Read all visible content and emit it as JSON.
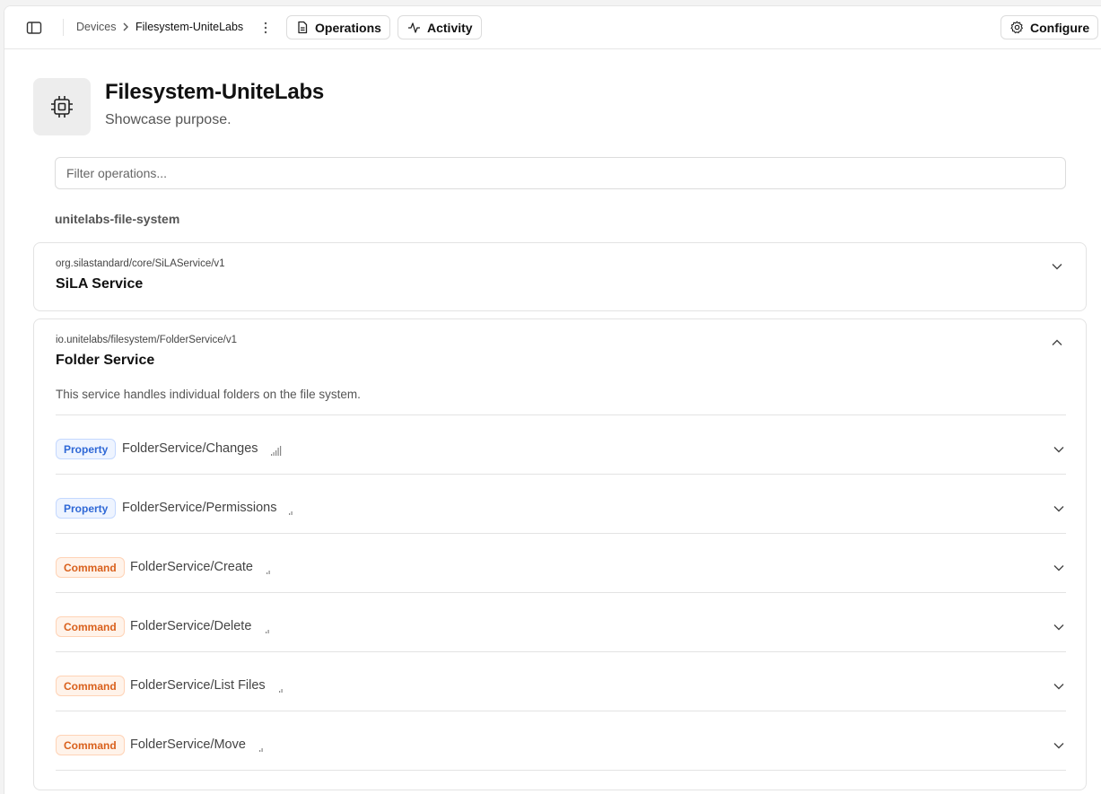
{
  "header": {
    "breadcrumb": {
      "devices": "Devices",
      "current": "Filesystem-UniteLabs"
    },
    "operations_label": "Operations",
    "activity_label": "Activity",
    "configure_label": "Configure"
  },
  "device": {
    "title": "Filesystem-UniteLabs",
    "subtitle": "Showcase purpose.",
    "icon": "chip-icon"
  },
  "filter": {
    "placeholder": "Filter operations..."
  },
  "group": {
    "label": "unitelabs-file-system"
  },
  "features": [
    {
      "id": "org.silastandard/core/SiLAService/v1",
      "name": "SiLA Service",
      "expanded": false
    },
    {
      "id": "io.unitelabs/filesystem/FolderService/v1",
      "name": "Folder Service",
      "expanded": true,
      "description": "This service handles individual folders on the file system.",
      "operations": [
        {
          "kind": "Property",
          "name": "FolderService/Changes",
          "indicator": "signal-bars-icon"
        },
        {
          "kind": "Property",
          "name": "FolderService/Permissions",
          "indicator": "signal-dot-icon"
        },
        {
          "kind": "Command",
          "name": "FolderService/Create",
          "indicator": "signal-dot-icon"
        },
        {
          "kind": "Command",
          "name": "FolderService/Delete",
          "indicator": "signal-dot-icon"
        },
        {
          "kind": "Command",
          "name": "FolderService/List Files",
          "indicator": "signal-dot-icon"
        },
        {
          "kind": "Command",
          "name": "FolderService/Move",
          "indicator": "signal-dot-icon"
        }
      ]
    }
  ],
  "colors": {
    "property_badge_text": "#2f68d6",
    "property_badge_bg": "#eef4ff",
    "command_badge_text": "#d9601c",
    "command_badge_bg": "#fff3ea"
  }
}
